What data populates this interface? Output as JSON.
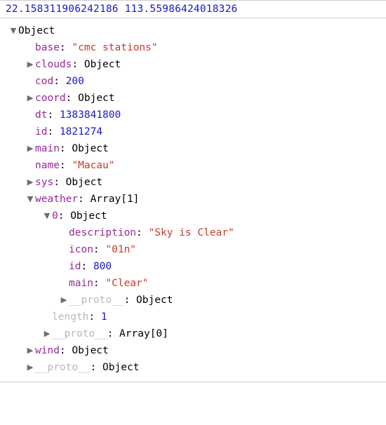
{
  "header": {
    "lat": "22.158311906242186",
    "lon": "113.55986424018326"
  },
  "tree": {
    "root_label": "Object",
    "base_key": "base",
    "base_val": "\"cmc stations\"",
    "clouds_key": "clouds",
    "clouds_val": "Object",
    "cod_key": "cod",
    "cod_val": "200",
    "coord_key": "coord",
    "coord_val": "Object",
    "dt_key": "dt",
    "dt_val": "1383841800",
    "id_key": "id",
    "id_val": "1821274",
    "main_key": "main",
    "main_val": "Object",
    "name_key": "name",
    "name_val": "\"Macau\"",
    "sys_key": "sys",
    "sys_val": "Object",
    "weather_key": "weather",
    "weather_val": "Array[1]",
    "w0_key": "0",
    "w0_val": "Object",
    "w0_description_key": "description",
    "w0_description_val": "\"Sky is Clear\"",
    "w0_icon_key": "icon",
    "w0_icon_val": "\"01n\"",
    "w0_id_key": "id",
    "w0_id_val": "800",
    "w0_main_key": "main",
    "w0_main_val": "\"Clear\"",
    "w0_proto_key": "__proto__",
    "w0_proto_val": "Object",
    "weather_length_key": "length",
    "weather_length_val": "1",
    "weather_proto_key": "__proto__",
    "weather_proto_val": "Array[0]",
    "wind_key": "wind",
    "wind_val": "Object",
    "proto_key": "__proto__",
    "proto_val": "Object"
  }
}
